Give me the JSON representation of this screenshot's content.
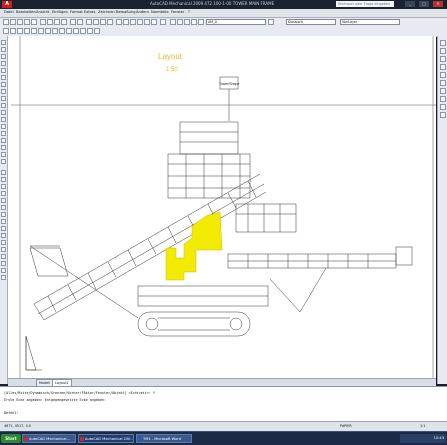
{
  "window": {
    "title": "AutoCAD Mechanical 2009  472 100-1-00  TOWER MAIN FRAME",
    "app_icon_letter": "A",
    "search_placeholder": "Stichwort oder Frage eingeben",
    "controls": [
      "_",
      "□",
      "✕"
    ]
  },
  "menu": [
    "Datei",
    "Bearbeiten",
    "Ansicht",
    "Einfügen",
    "Format",
    "Extras",
    "Zeichnen",
    "Bemaßung",
    "Ändern",
    "Normteile",
    "Fenster",
    "?"
  ],
  "toolbar": {
    "layer_combo": "AM_0",
    "style_combo": "Klassisch",
    "linetype_combo": "VonLayer"
  },
  "drawing": {
    "layout_title": "Layout",
    "layout_subtitle": "1:50",
    "title_block_label": "Tower/Shape",
    "highlight_color": "#f2ea00"
  },
  "tabs": [
    {
      "label": "Modell",
      "active": false
    },
    {
      "label": "Layout1",
      "active": true
    }
  ],
  "command": {
    "line1": "[Alles/Mitte/Dynamisch/Grenzen/Vorher/FAktor/Fenster/Objekt] <Echtzeit>: f",
    "line2": "Erste Ecke angeben: Entgegengesetzte Ecke angeben:",
    "line3": "Befehl:"
  },
  "status": {
    "coords": "4671, 4517, 0.0",
    "paper": "PAPIER",
    "scale": "1:1"
  },
  "taskbar": {
    "start": "Start",
    "tasks": [
      {
        "label": "AutoCAD Mechanical...",
        "active": false
      },
      {
        "label": "AutoCAD Mechanical 200...",
        "active": true
      },
      {
        "label": "TM1 - Microsoft Word",
        "active": false
      }
    ],
    "clock": "10:43"
  }
}
